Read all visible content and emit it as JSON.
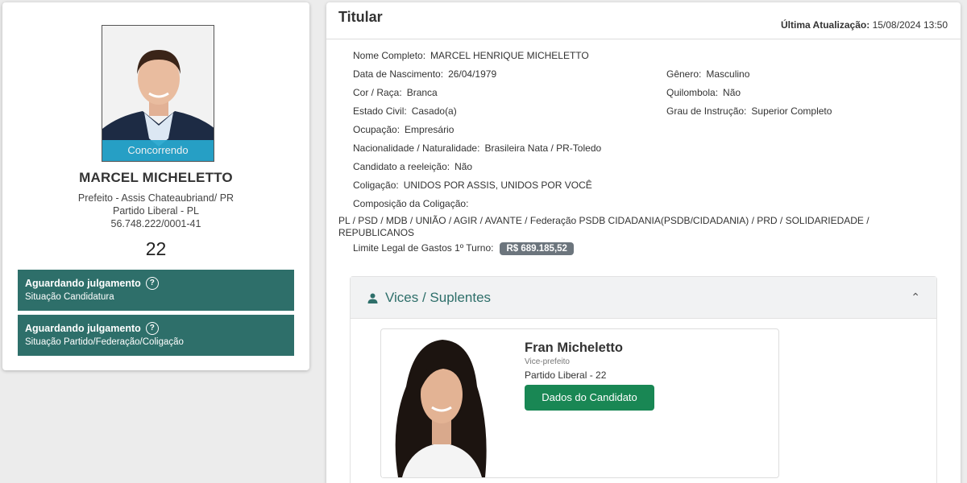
{
  "candidate": {
    "status_ribbon": "Concorrendo",
    "name": "MARCEL MICHELETTO",
    "office_line": "Prefeito - Assis Chateaubriand/ PR",
    "party_line": "Partido Liberal - PL",
    "cnpj": "56.748.222/0001-41",
    "number": "22",
    "statuses": [
      {
        "title": "Aguardando julgamento",
        "subtitle": "Situação Candidatura"
      },
      {
        "title": "Aguardando julgamento",
        "subtitle": "Situação Partido/Federação/Coligação"
      }
    ],
    "help_icon": "question-circle-icon"
  },
  "panel": {
    "title": "Titular",
    "last_update_label": "Última Atualização:",
    "last_update_value": "15/08/2024 13:50"
  },
  "fields": {
    "full_name": {
      "label": "Nome Completo:",
      "value": "MARCEL HENRIQUE MICHELETTO"
    },
    "birth_date": {
      "label": "Data de Nascimento:",
      "value": "26/04/1979"
    },
    "gender": {
      "label": "Gênero:",
      "value": "Masculino"
    },
    "race": {
      "label": "Cor / Raça:",
      "value": "Branca"
    },
    "quilombola": {
      "label": "Quilombola:",
      "value": "Não"
    },
    "marital_status": {
      "label": "Estado Civil:",
      "value": "Casado(a)"
    },
    "education": {
      "label": "Grau de Instrução:",
      "value": "Superior Completo"
    },
    "occupation": {
      "label": "Ocupação:",
      "value": "Empresário"
    },
    "nationality": {
      "label": "Nacionalidade / Naturalidade:",
      "value": "Brasileira Nata / PR-Toledo"
    },
    "reelection": {
      "label": "Candidato a reeleição:",
      "value": "Não"
    },
    "coalition": {
      "label": "Coligação:",
      "value": "UNIDOS POR ASSIS, UNIDOS POR VOCÊ"
    },
    "coalition_composition": {
      "label": "Composição da Coligação:"
    },
    "coalition_parties": "PL / PSD / MDB / UNIÃO / AGIR / AVANTE / Federação PSDB CIDADANIA(PSDB/CIDADANIA) / PRD / SOLIDARIEDADE / REPUBLICANOS",
    "spending_limit": {
      "label": "Limite Legal de Gastos 1º Turno:",
      "value": "R$ 689.185,52"
    }
  },
  "vices": {
    "section_title": "Vices / Suplentes",
    "icon": "person-icon",
    "collapse_icon": "chevron-up-icon",
    "items": [
      {
        "name": "Fran Micheletto",
        "role": "Vice-prefeito",
        "party": "Partido Liberal - 22",
        "button_label": "Dados do Candidato"
      }
    ]
  },
  "colors": {
    "status_teal": "#2e6f6a",
    "ribbon_blue": "#27a8cf",
    "button_green": "#198754",
    "badge_gray": "#6c757d"
  }
}
